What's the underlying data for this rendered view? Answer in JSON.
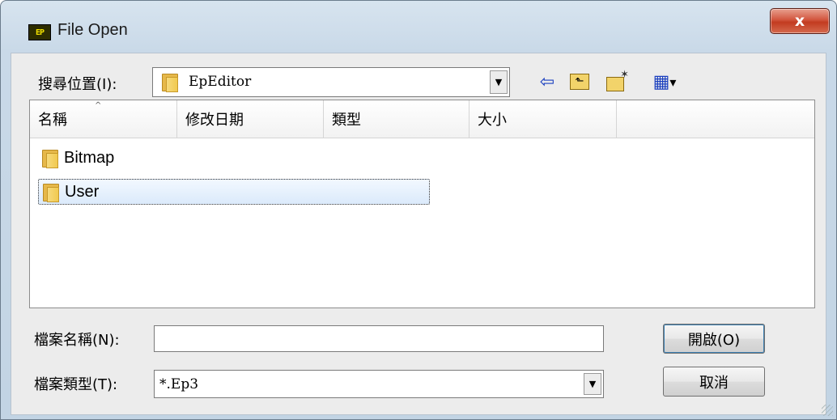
{
  "window": {
    "title": "File Open",
    "app_icon_text": "EP",
    "close_glyph": "x"
  },
  "look_in": {
    "label": "搜尋位置(I):",
    "value": "EpEditor",
    "arrow": "▼"
  },
  "toolbar": {
    "back_glyph": "⇦",
    "up_glyph": "⬑",
    "new_folder_glyph": "✶",
    "view_glyph": "▦",
    "view_menu_glyph": "▾"
  },
  "listview": {
    "columns": [
      "名稱",
      "修改日期",
      "類型",
      "大小"
    ],
    "sort_indicator": "^",
    "items": [
      {
        "name": "Bitmap",
        "selected": false
      },
      {
        "name": "User",
        "selected": true
      }
    ]
  },
  "filename": {
    "label": "檔案名稱(N):",
    "value": ""
  },
  "filetype": {
    "label": "檔案類型(T):",
    "value": "*.Ep3",
    "arrow": "▼"
  },
  "buttons": {
    "open": "開啟(O)",
    "cancel": "取消"
  },
  "colors": {
    "folder": "#e6b84a",
    "close": "#c23b20",
    "selection": "#dbeafb"
  }
}
